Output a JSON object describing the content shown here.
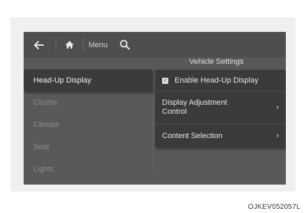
{
  "header": {
    "menu_label": "Menu"
  },
  "icons": {
    "back": "back-arrow-icon",
    "home": "home-icon",
    "search": "search-icon"
  },
  "page_title": "Vehicle Settings",
  "sidebar": {
    "items": [
      {
        "label": "Head-Up Display",
        "selected": true
      },
      {
        "label": "Cluster",
        "selected": false
      },
      {
        "label": "Climate",
        "selected": false
      },
      {
        "label": "Seat",
        "selected": false
      },
      {
        "label": "Lights",
        "selected": false
      }
    ]
  },
  "options": [
    {
      "label": "Enable Head-Up Display",
      "checked": true
    },
    {
      "label": "Display Adjustment\nControl",
      "chevron": "›"
    },
    {
      "label": "Content Selection",
      "chevron": "›"
    }
  ],
  "caption": "OJKEV052057L",
  "colors": {
    "screen_bg": "#595959",
    "panel_bg": "#3a3a3a",
    "selected_bg": "#3b3b3b"
  }
}
